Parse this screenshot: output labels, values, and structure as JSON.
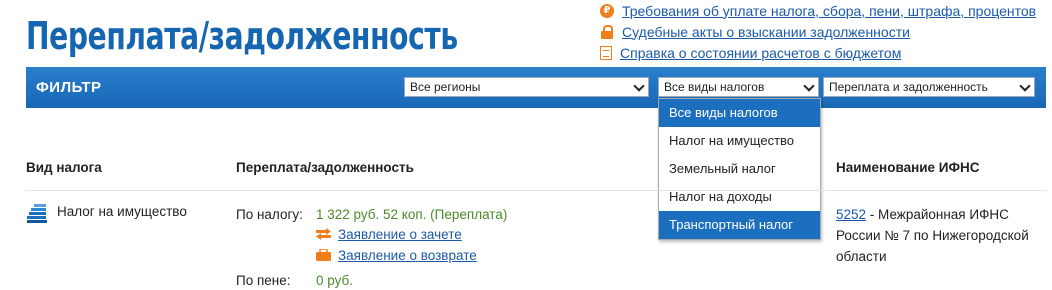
{
  "title": "Переплата/задолженность",
  "top_links": [
    {
      "icon": "ruble-icon",
      "text": "Требования об уплате налога, сбора, пени, штрафа, процентов"
    },
    {
      "icon": "lock-icon",
      "text": "Судебные акты о взыскании задолженности"
    },
    {
      "icon": "document-icon",
      "text": "Справка о состоянии расчетов с бюджетом"
    }
  ],
  "filter": {
    "label": "ФИЛЬТР",
    "region": "Все регионы",
    "tax_type": "Все виды налогов",
    "status": "Переплата и задолженность",
    "tax_options": [
      "Все виды налогов",
      "Налог на имущество",
      "Земельный налог",
      "Налог на доходы",
      "Транспортный налог"
    ],
    "highlighted_option": "Транспортный налог"
  },
  "table": {
    "headers": [
      "Вид налога",
      "Переплата/задолженность",
      "Наименование ИФНС"
    ],
    "rows": [
      {
        "tax": "Налог на имущество",
        "tax_label": "По налогу:",
        "tax_value": "1 322 руб. 52 коп. (Переплата)",
        "offset_link": "Заявление о зачете",
        "refund_link": "Заявление о возврате",
        "penalty_label": "По пене:",
        "penalty_value": "0 руб.",
        "ifns_code": "5252",
        "ifns_name": " - Межрайонная ИФНС России № 7 по Нижегородской области"
      }
    ]
  },
  "colors": {
    "brand": "#1b6fbe",
    "accent": "#f07e1b",
    "value": "#4a8a2a",
    "link": "#1b5aa8"
  }
}
